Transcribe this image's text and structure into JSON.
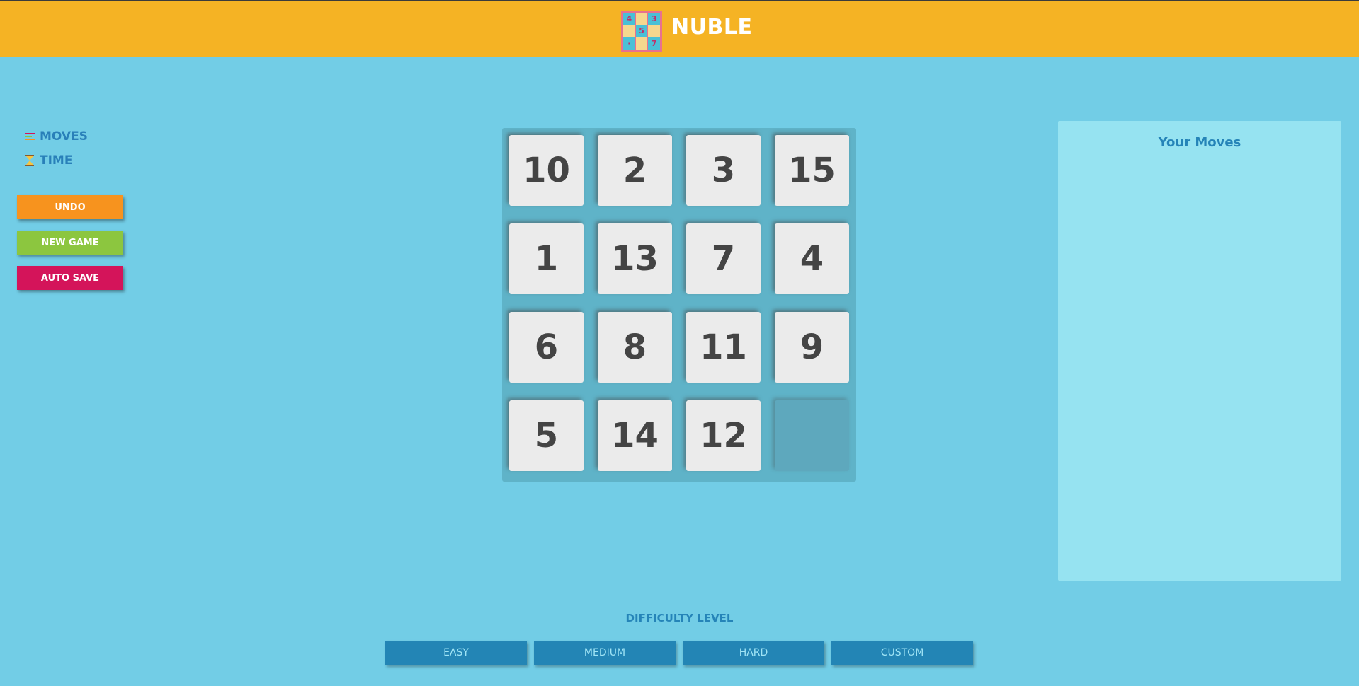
{
  "app": {
    "title": "NUBLE",
    "logo_cells": [
      "4",
      "",
      "3",
      "",
      "5",
      "",
      "·",
      "",
      "7"
    ]
  },
  "stats": {
    "moves_label": "MOVES",
    "time_label": "TIME",
    "moves_icon": "moves-icon",
    "time_icon": "hourglass-icon"
  },
  "actions": {
    "undo": "UNDO",
    "new_game": "NEW GAME",
    "auto_save": "AUTO SAVE"
  },
  "board": {
    "size": 4,
    "tiles": [
      "10",
      "2",
      "3",
      "15",
      "1",
      "13",
      "7",
      "4",
      "6",
      "8",
      "11",
      "9",
      "5",
      "14",
      "12",
      ""
    ]
  },
  "moves_panel": {
    "title": "Your Moves",
    "items": []
  },
  "difficulty": {
    "label": "DIFFICULTY LEVEL",
    "options": [
      "EASY",
      "MEDIUM",
      "HARD",
      "CUSTOM"
    ]
  },
  "colors": {
    "background": "#72cde6",
    "header": "#f5b324",
    "undo": "#f7931e",
    "new_game": "#8cc63f",
    "auto_save": "#d4145a",
    "difficulty_button": "#2385b5",
    "tile": "#ebebeb",
    "tile_text": "#444444"
  }
}
